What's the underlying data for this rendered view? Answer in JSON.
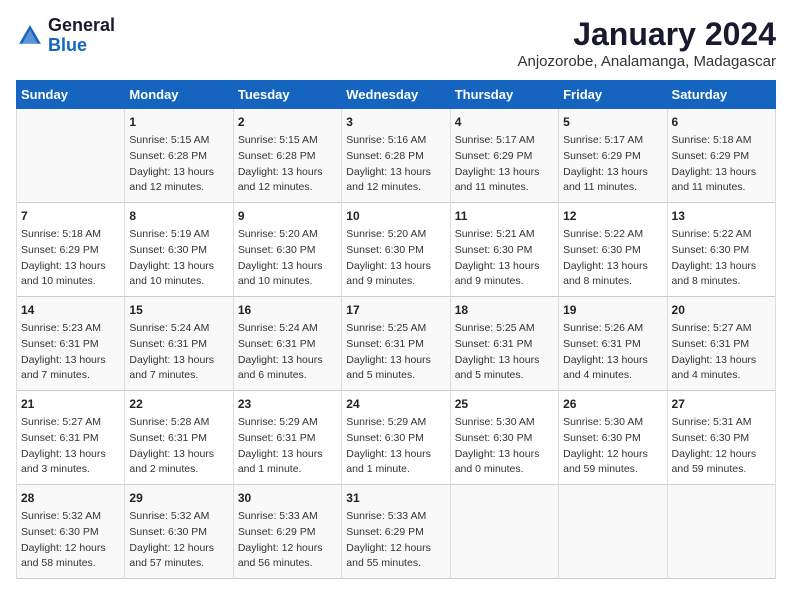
{
  "app": {
    "logo_line1": "General",
    "logo_line2": "Blue",
    "title": "January 2024",
    "subtitle": "Anjozorobe, Analamanga, Madagascar"
  },
  "calendar": {
    "headers": [
      "Sunday",
      "Monday",
      "Tuesday",
      "Wednesday",
      "Thursday",
      "Friday",
      "Saturday"
    ],
    "weeks": [
      [
        {
          "day": "",
          "info": ""
        },
        {
          "day": "1",
          "info": "Sunrise: 5:15 AM\nSunset: 6:28 PM\nDaylight: 13 hours\nand 12 minutes."
        },
        {
          "day": "2",
          "info": "Sunrise: 5:15 AM\nSunset: 6:28 PM\nDaylight: 13 hours\nand 12 minutes."
        },
        {
          "day": "3",
          "info": "Sunrise: 5:16 AM\nSunset: 6:28 PM\nDaylight: 13 hours\nand 12 minutes."
        },
        {
          "day": "4",
          "info": "Sunrise: 5:17 AM\nSunset: 6:29 PM\nDaylight: 13 hours\nand 11 minutes."
        },
        {
          "day": "5",
          "info": "Sunrise: 5:17 AM\nSunset: 6:29 PM\nDaylight: 13 hours\nand 11 minutes."
        },
        {
          "day": "6",
          "info": "Sunrise: 5:18 AM\nSunset: 6:29 PM\nDaylight: 13 hours\nand 11 minutes."
        }
      ],
      [
        {
          "day": "7",
          "info": "Sunrise: 5:18 AM\nSunset: 6:29 PM\nDaylight: 13 hours\nand 10 minutes."
        },
        {
          "day": "8",
          "info": "Sunrise: 5:19 AM\nSunset: 6:30 PM\nDaylight: 13 hours\nand 10 minutes."
        },
        {
          "day": "9",
          "info": "Sunrise: 5:20 AM\nSunset: 6:30 PM\nDaylight: 13 hours\nand 10 minutes."
        },
        {
          "day": "10",
          "info": "Sunrise: 5:20 AM\nSunset: 6:30 PM\nDaylight: 13 hours\nand 9 minutes."
        },
        {
          "day": "11",
          "info": "Sunrise: 5:21 AM\nSunset: 6:30 PM\nDaylight: 13 hours\nand 9 minutes."
        },
        {
          "day": "12",
          "info": "Sunrise: 5:22 AM\nSunset: 6:30 PM\nDaylight: 13 hours\nand 8 minutes."
        },
        {
          "day": "13",
          "info": "Sunrise: 5:22 AM\nSunset: 6:30 PM\nDaylight: 13 hours\nand 8 minutes."
        }
      ],
      [
        {
          "day": "14",
          "info": "Sunrise: 5:23 AM\nSunset: 6:31 PM\nDaylight: 13 hours\nand 7 minutes."
        },
        {
          "day": "15",
          "info": "Sunrise: 5:24 AM\nSunset: 6:31 PM\nDaylight: 13 hours\nand 7 minutes."
        },
        {
          "day": "16",
          "info": "Sunrise: 5:24 AM\nSunset: 6:31 PM\nDaylight: 13 hours\nand 6 minutes."
        },
        {
          "day": "17",
          "info": "Sunrise: 5:25 AM\nSunset: 6:31 PM\nDaylight: 13 hours\nand 5 minutes."
        },
        {
          "day": "18",
          "info": "Sunrise: 5:25 AM\nSunset: 6:31 PM\nDaylight: 13 hours\nand 5 minutes."
        },
        {
          "day": "19",
          "info": "Sunrise: 5:26 AM\nSunset: 6:31 PM\nDaylight: 13 hours\nand 4 minutes."
        },
        {
          "day": "20",
          "info": "Sunrise: 5:27 AM\nSunset: 6:31 PM\nDaylight: 13 hours\nand 4 minutes."
        }
      ],
      [
        {
          "day": "21",
          "info": "Sunrise: 5:27 AM\nSunset: 6:31 PM\nDaylight: 13 hours\nand 3 minutes."
        },
        {
          "day": "22",
          "info": "Sunrise: 5:28 AM\nSunset: 6:31 PM\nDaylight: 13 hours\nand 2 minutes."
        },
        {
          "day": "23",
          "info": "Sunrise: 5:29 AM\nSunset: 6:31 PM\nDaylight: 13 hours\nand 1 minute."
        },
        {
          "day": "24",
          "info": "Sunrise: 5:29 AM\nSunset: 6:30 PM\nDaylight: 13 hours\nand 1 minute."
        },
        {
          "day": "25",
          "info": "Sunrise: 5:30 AM\nSunset: 6:30 PM\nDaylight: 13 hours\nand 0 minutes."
        },
        {
          "day": "26",
          "info": "Sunrise: 5:30 AM\nSunset: 6:30 PM\nDaylight: 12 hours\nand 59 minutes."
        },
        {
          "day": "27",
          "info": "Sunrise: 5:31 AM\nSunset: 6:30 PM\nDaylight: 12 hours\nand 59 minutes."
        }
      ],
      [
        {
          "day": "28",
          "info": "Sunrise: 5:32 AM\nSunset: 6:30 PM\nDaylight: 12 hours\nand 58 minutes."
        },
        {
          "day": "29",
          "info": "Sunrise: 5:32 AM\nSunset: 6:30 PM\nDaylight: 12 hours\nand 57 minutes."
        },
        {
          "day": "30",
          "info": "Sunrise: 5:33 AM\nSunset: 6:29 PM\nDaylight: 12 hours\nand 56 minutes."
        },
        {
          "day": "31",
          "info": "Sunrise: 5:33 AM\nSunset: 6:29 PM\nDaylight: 12 hours\nand 55 minutes."
        },
        {
          "day": "",
          "info": ""
        },
        {
          "day": "",
          "info": ""
        },
        {
          "day": "",
          "info": ""
        }
      ]
    ]
  }
}
